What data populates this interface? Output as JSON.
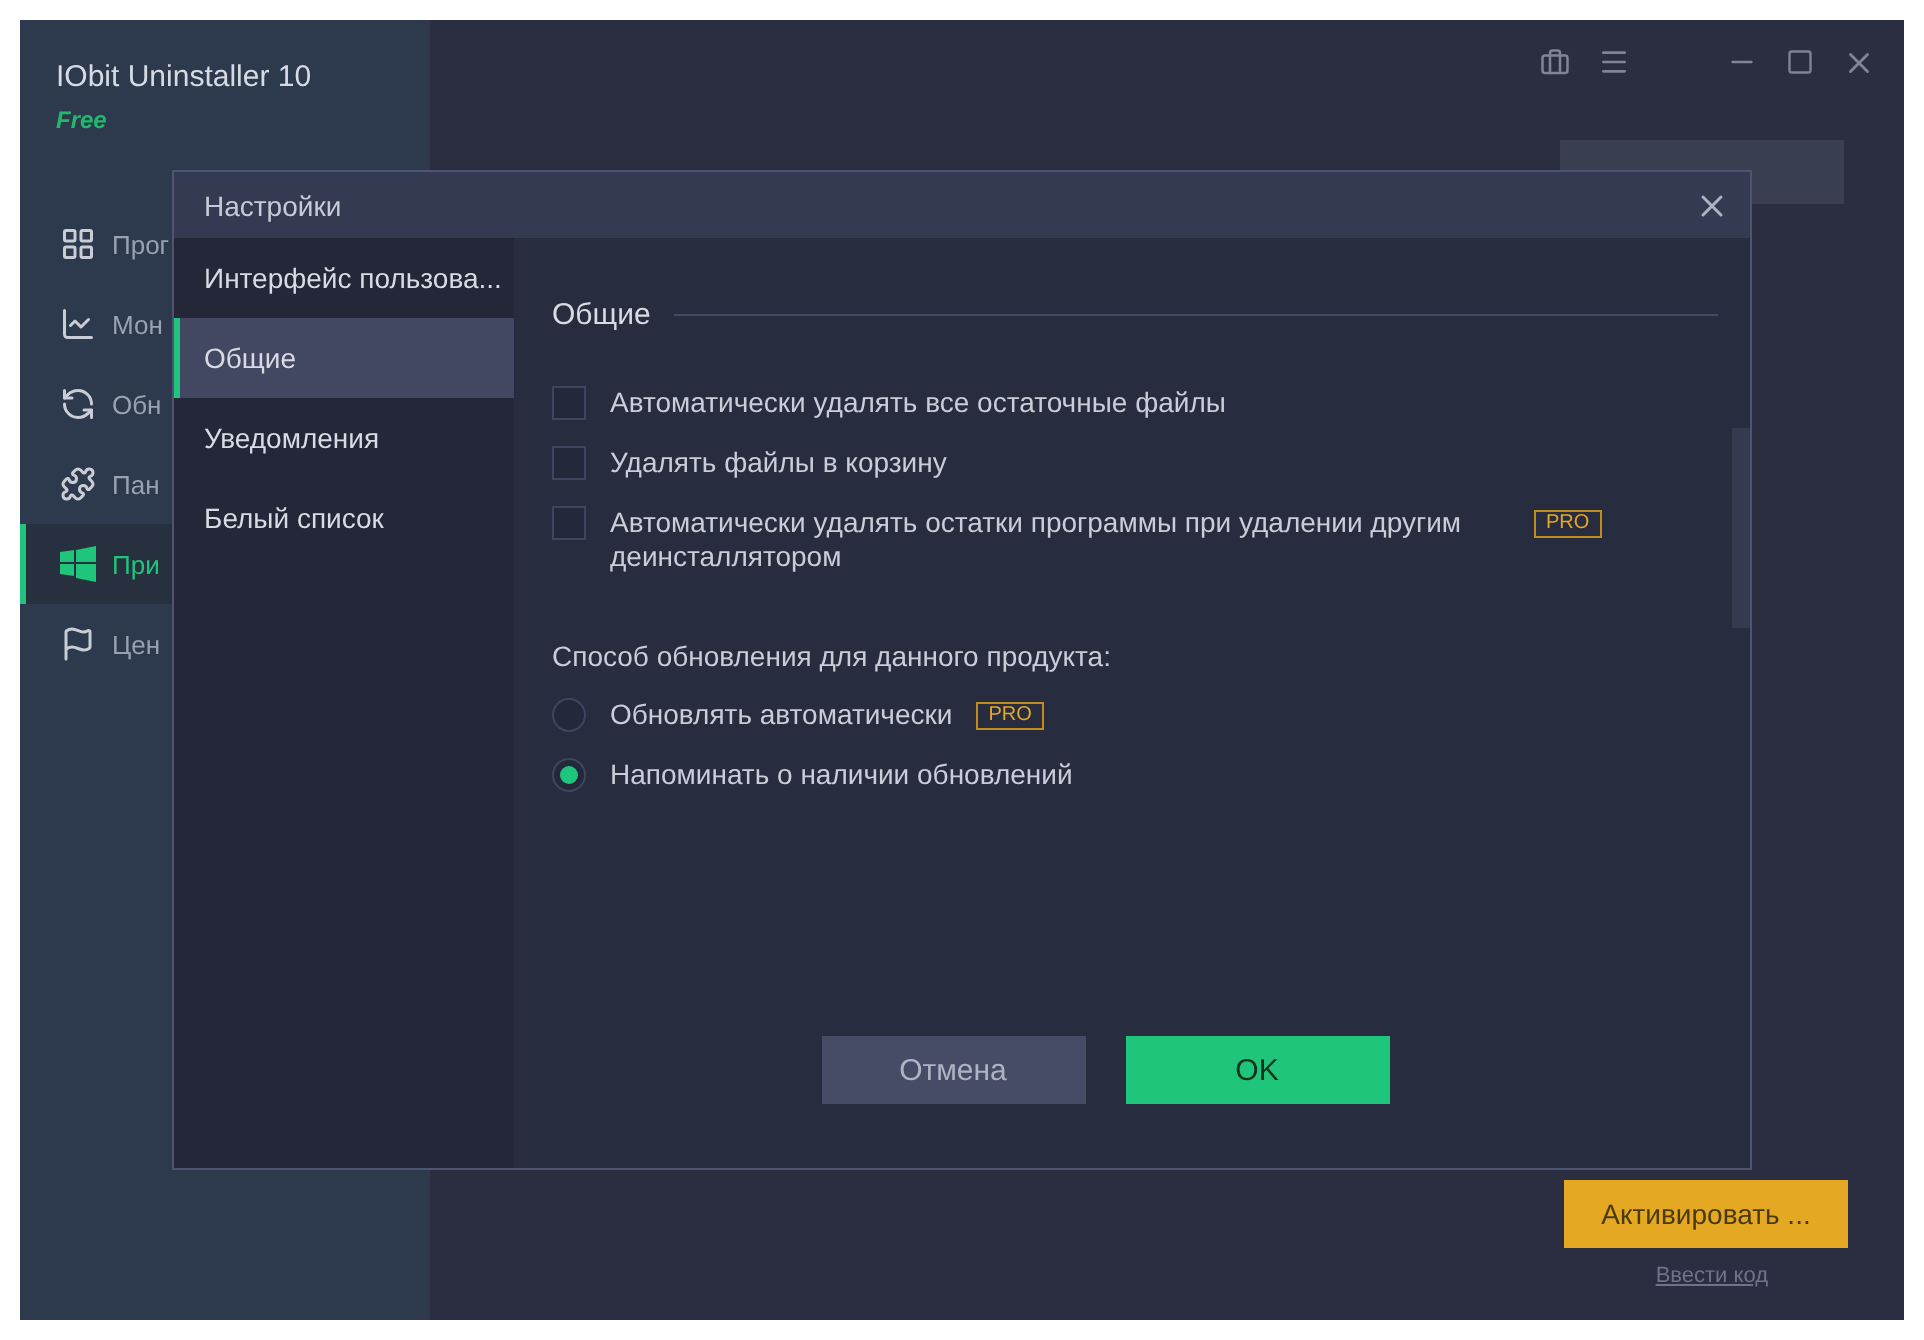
{
  "app": {
    "title": "IObit Uninstaller 10",
    "edition": "Free",
    "sidebar": [
      {
        "label": "Прог",
        "selected": false
      },
      {
        "label": "Мон",
        "selected": false
      },
      {
        "label": "Обн",
        "selected": false
      },
      {
        "label": "Пан",
        "selected": false
      },
      {
        "label": "При",
        "selected": true
      },
      {
        "label": "Цен",
        "selected": false
      }
    ],
    "activate_button": "Активировать ...",
    "enter_code_link": "Ввести код"
  },
  "dialog": {
    "title": "Настройки",
    "nav": [
      {
        "label": "Интерфейс пользова...",
        "selected": false
      },
      {
        "label": "Общие",
        "selected": true
      },
      {
        "label": "Уведомления",
        "selected": false
      },
      {
        "label": "Белый список",
        "selected": false
      }
    ],
    "section_title": "Общие",
    "options": [
      {
        "label": "Автоматически удалять все остаточные файлы",
        "checked": false
      },
      {
        "label": "Удалять файлы в корзину",
        "checked": false
      },
      {
        "label": "Автоматически удалять остатки программы при удалении другим деинсталлятором",
        "checked": false,
        "badge": "PRO"
      }
    ],
    "update_label": "Способ обновления для данного продукта:",
    "update_modes": [
      {
        "label": "Обновлять автоматически",
        "selected": false,
        "badge": "PRO"
      },
      {
        "label": "Напоминать о наличии обновлений",
        "selected": true
      }
    ],
    "cancel_button": "Отмена",
    "ok_button": "OK"
  }
}
